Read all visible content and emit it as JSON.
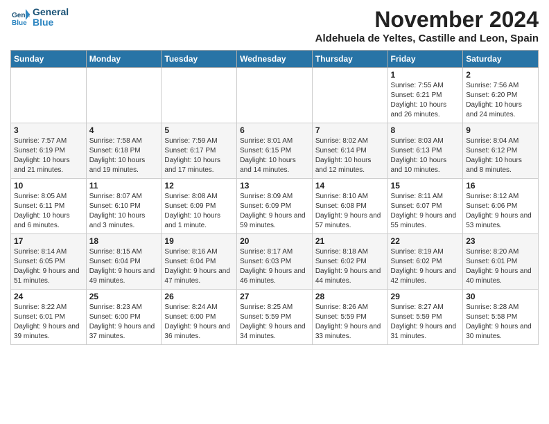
{
  "header": {
    "logo_line1": "General",
    "logo_line2": "Blue",
    "month_title": "November 2024",
    "subtitle": "Aldehuela de Yeltes, Castille and Leon, Spain"
  },
  "weekdays": [
    "Sunday",
    "Monday",
    "Tuesday",
    "Wednesday",
    "Thursday",
    "Friday",
    "Saturday"
  ],
  "weeks": [
    [
      {
        "day": "",
        "info": ""
      },
      {
        "day": "",
        "info": ""
      },
      {
        "day": "",
        "info": ""
      },
      {
        "day": "",
        "info": ""
      },
      {
        "day": "",
        "info": ""
      },
      {
        "day": "1",
        "info": "Sunrise: 7:55 AM\nSunset: 6:21 PM\nDaylight: 10 hours and 26 minutes."
      },
      {
        "day": "2",
        "info": "Sunrise: 7:56 AM\nSunset: 6:20 PM\nDaylight: 10 hours and 24 minutes."
      }
    ],
    [
      {
        "day": "3",
        "info": "Sunrise: 7:57 AM\nSunset: 6:19 PM\nDaylight: 10 hours and 21 minutes."
      },
      {
        "day": "4",
        "info": "Sunrise: 7:58 AM\nSunset: 6:18 PM\nDaylight: 10 hours and 19 minutes."
      },
      {
        "day": "5",
        "info": "Sunrise: 7:59 AM\nSunset: 6:17 PM\nDaylight: 10 hours and 17 minutes."
      },
      {
        "day": "6",
        "info": "Sunrise: 8:01 AM\nSunset: 6:15 PM\nDaylight: 10 hours and 14 minutes."
      },
      {
        "day": "7",
        "info": "Sunrise: 8:02 AM\nSunset: 6:14 PM\nDaylight: 10 hours and 12 minutes."
      },
      {
        "day": "8",
        "info": "Sunrise: 8:03 AM\nSunset: 6:13 PM\nDaylight: 10 hours and 10 minutes."
      },
      {
        "day": "9",
        "info": "Sunrise: 8:04 AM\nSunset: 6:12 PM\nDaylight: 10 hours and 8 minutes."
      }
    ],
    [
      {
        "day": "10",
        "info": "Sunrise: 8:05 AM\nSunset: 6:11 PM\nDaylight: 10 hours and 6 minutes."
      },
      {
        "day": "11",
        "info": "Sunrise: 8:07 AM\nSunset: 6:10 PM\nDaylight: 10 hours and 3 minutes."
      },
      {
        "day": "12",
        "info": "Sunrise: 8:08 AM\nSunset: 6:09 PM\nDaylight: 10 hours and 1 minute."
      },
      {
        "day": "13",
        "info": "Sunrise: 8:09 AM\nSunset: 6:09 PM\nDaylight: 9 hours and 59 minutes."
      },
      {
        "day": "14",
        "info": "Sunrise: 8:10 AM\nSunset: 6:08 PM\nDaylight: 9 hours and 57 minutes."
      },
      {
        "day": "15",
        "info": "Sunrise: 8:11 AM\nSunset: 6:07 PM\nDaylight: 9 hours and 55 minutes."
      },
      {
        "day": "16",
        "info": "Sunrise: 8:12 AM\nSunset: 6:06 PM\nDaylight: 9 hours and 53 minutes."
      }
    ],
    [
      {
        "day": "17",
        "info": "Sunrise: 8:14 AM\nSunset: 6:05 PM\nDaylight: 9 hours and 51 minutes."
      },
      {
        "day": "18",
        "info": "Sunrise: 8:15 AM\nSunset: 6:04 PM\nDaylight: 9 hours and 49 minutes."
      },
      {
        "day": "19",
        "info": "Sunrise: 8:16 AM\nSunset: 6:04 PM\nDaylight: 9 hours and 47 minutes."
      },
      {
        "day": "20",
        "info": "Sunrise: 8:17 AM\nSunset: 6:03 PM\nDaylight: 9 hours and 46 minutes."
      },
      {
        "day": "21",
        "info": "Sunrise: 8:18 AM\nSunset: 6:02 PM\nDaylight: 9 hours and 44 minutes."
      },
      {
        "day": "22",
        "info": "Sunrise: 8:19 AM\nSunset: 6:02 PM\nDaylight: 9 hours and 42 minutes."
      },
      {
        "day": "23",
        "info": "Sunrise: 8:20 AM\nSunset: 6:01 PM\nDaylight: 9 hours and 40 minutes."
      }
    ],
    [
      {
        "day": "24",
        "info": "Sunrise: 8:22 AM\nSunset: 6:01 PM\nDaylight: 9 hours and 39 minutes."
      },
      {
        "day": "25",
        "info": "Sunrise: 8:23 AM\nSunset: 6:00 PM\nDaylight: 9 hours and 37 minutes."
      },
      {
        "day": "26",
        "info": "Sunrise: 8:24 AM\nSunset: 6:00 PM\nDaylight: 9 hours and 36 minutes."
      },
      {
        "day": "27",
        "info": "Sunrise: 8:25 AM\nSunset: 5:59 PM\nDaylight: 9 hours and 34 minutes."
      },
      {
        "day": "28",
        "info": "Sunrise: 8:26 AM\nSunset: 5:59 PM\nDaylight: 9 hours and 33 minutes."
      },
      {
        "day": "29",
        "info": "Sunrise: 8:27 AM\nSunset: 5:59 PM\nDaylight: 9 hours and 31 minutes."
      },
      {
        "day": "30",
        "info": "Sunrise: 8:28 AM\nSunset: 5:58 PM\nDaylight: 9 hours and 30 minutes."
      }
    ]
  ]
}
